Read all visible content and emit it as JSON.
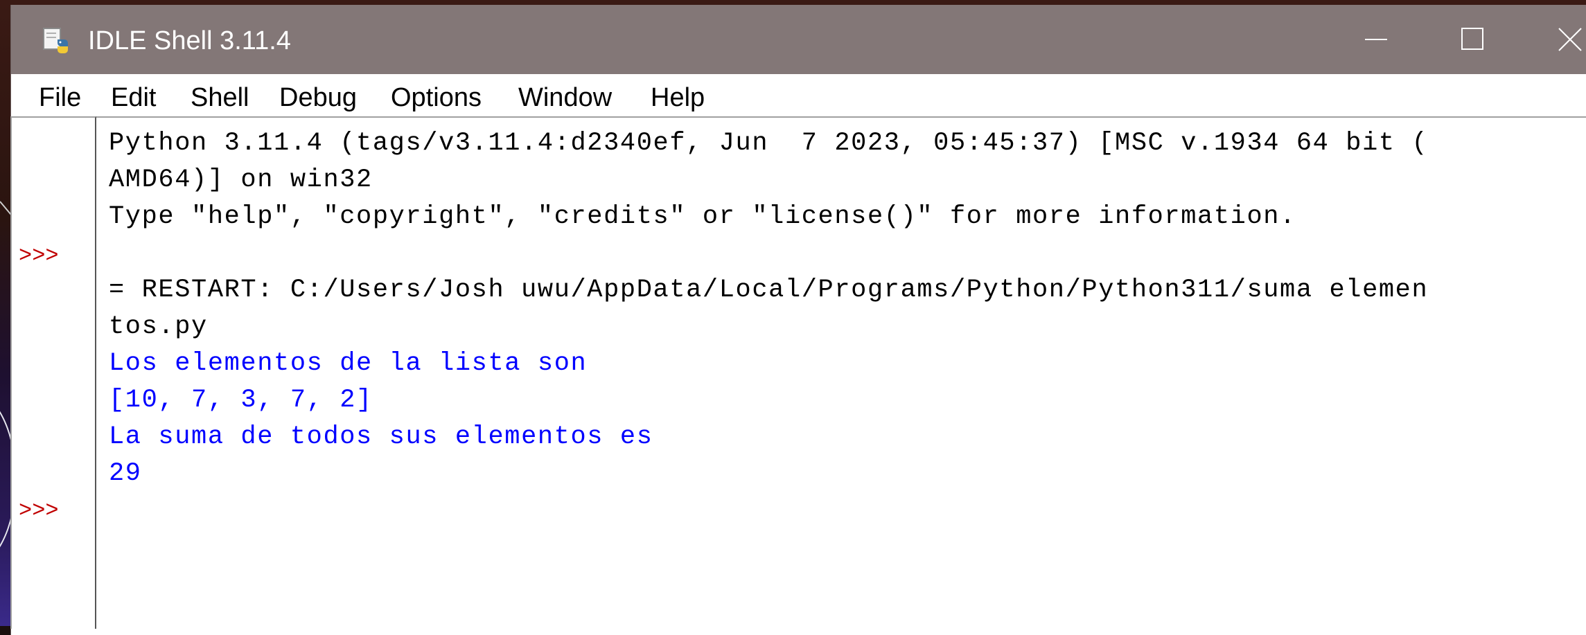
{
  "window": {
    "title": "IDLE Shell 3.11.4",
    "title_bar_color": "#837777",
    "controls": {
      "minimize_icon": "minimize-icon",
      "maximize_icon": "maximize-icon",
      "close_icon": "close-icon"
    }
  },
  "menubar": {
    "items": [
      "File",
      "Edit",
      "Shell",
      "Debug",
      "Options",
      "Window",
      "Help"
    ]
  },
  "shell": {
    "prompt": ">>>",
    "prompt_color": "#c00000",
    "stdout_color": "#0000ff",
    "lines": [
      {
        "text": "Python 3.11.4 (tags/v3.11.4:d2340ef, Jun  7 2023, 05:45:37) [MSC v.1934 64 bit (",
        "kind": "banner"
      },
      {
        "text": "AMD64)] on win32",
        "kind": "banner"
      },
      {
        "text": "Type \"help\", \"copyright\", \"credits\" or \"license()\" for more information.",
        "kind": "banner"
      },
      {
        "text": "",
        "kind": "prompt"
      },
      {
        "text": "= RESTART: C:/Users/Josh uwu/AppData/Local/Programs/Python/Python311/suma elemen",
        "kind": "restart"
      },
      {
        "text": "tos.py",
        "kind": "restart"
      },
      {
        "text": "Los elementos de la lista son",
        "kind": "stdout"
      },
      {
        "text": "[10, 7, 3, 7, 2]",
        "kind": "stdout"
      },
      {
        "text": "La suma de todos sus elementos es",
        "kind": "stdout"
      },
      {
        "text": "29",
        "kind": "stdout"
      },
      {
        "text": "",
        "kind": "prompt"
      }
    ]
  }
}
